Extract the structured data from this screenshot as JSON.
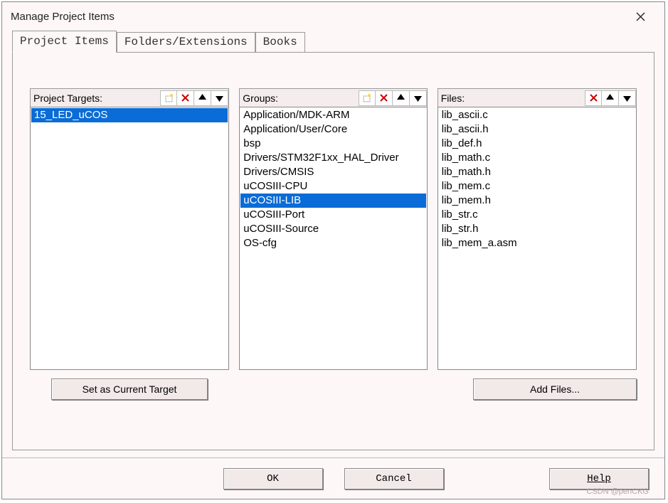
{
  "title": "Manage Project Items",
  "tabs": [
    {
      "label": "Project Items",
      "active": true
    },
    {
      "label": "Folders/Extensions",
      "active": false
    },
    {
      "label": "Books",
      "active": false
    }
  ],
  "columns": {
    "targets": {
      "label": "Project Targets:",
      "icons": [
        "new",
        "delete",
        "up",
        "down"
      ],
      "items": [
        {
          "text": "15_LED_uCOS",
          "selected": true
        }
      ]
    },
    "groups": {
      "label": "Groups:",
      "icons": [
        "new",
        "delete",
        "up",
        "down"
      ],
      "items": [
        {
          "text": "Application/MDK-ARM",
          "selected": false
        },
        {
          "text": "Application/User/Core",
          "selected": false
        },
        {
          "text": "bsp",
          "selected": false
        },
        {
          "text": "Drivers/STM32F1xx_HAL_Driver",
          "selected": false
        },
        {
          "text": "Drivers/CMSIS",
          "selected": false
        },
        {
          "text": "uCOSIII-CPU",
          "selected": false
        },
        {
          "text": "uCOSIII-LIB",
          "selected": true
        },
        {
          "text": "uCOSIII-Port",
          "selected": false
        },
        {
          "text": "uCOSIII-Source",
          "selected": false
        },
        {
          "text": "OS-cfg",
          "selected": false
        }
      ]
    },
    "files": {
      "label": "Files:",
      "icons": [
        "delete",
        "up",
        "down"
      ],
      "items": [
        {
          "text": "lib_ascii.c",
          "selected": false
        },
        {
          "text": "lib_ascii.h",
          "selected": false
        },
        {
          "text": "lib_def.h",
          "selected": false
        },
        {
          "text": "lib_math.c",
          "selected": false
        },
        {
          "text": "lib_math.h",
          "selected": false
        },
        {
          "text": "lib_mem.c",
          "selected": false
        },
        {
          "text": "lib_mem.h",
          "selected": false
        },
        {
          "text": "lib_str.c",
          "selected": false
        },
        {
          "text": "lib_str.h",
          "selected": false
        },
        {
          "text": "lib_mem_a.asm",
          "selected": false
        }
      ]
    }
  },
  "buttons": {
    "set_target": "Set as Current Target",
    "add_files": "Add Files...",
    "ok": "OK",
    "cancel": "Cancel",
    "help": "Help"
  },
  "watermark": "CSDN @penCKG",
  "icon_svg": {
    "new": "<rect x='2' y='4' width='9' height='8' fill='none' stroke='#777' stroke-dasharray='1 1'/><circle cx='10' cy='3' r='2' fill='#ffd640'/>",
    "delete": "<line x1='2' y1='2' x2='11' y2='11' stroke='#c00' stroke-width='2'/><line x1='11' y1='2' x2='2' y2='11' stroke='#c00' stroke-width='2'/>",
    "up": "<polygon points='6.5,1 12,9 1,9' fill='#000'/>",
    "down": "<polygon points='6.5,12 12,4 1,4' fill='#000'/>"
  }
}
